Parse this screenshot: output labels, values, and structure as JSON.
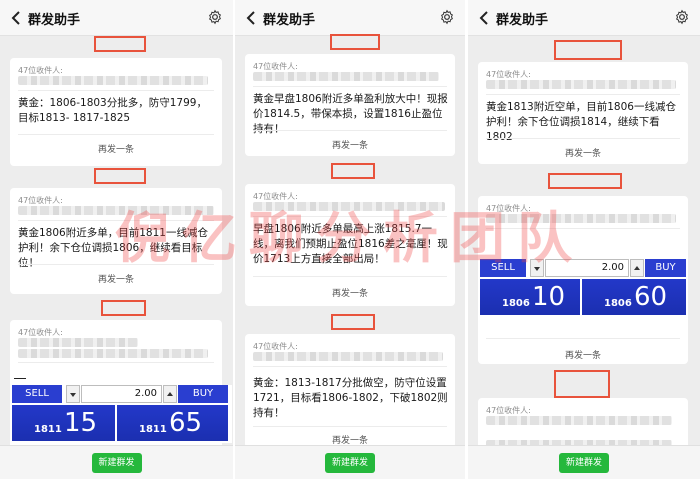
{
  "header": {
    "title": "群发助手"
  },
  "receiver_label": "47位收件人:",
  "resend_label": "再发一条",
  "new_broadcast_label": "新建群发",
  "watermark": "倪亿聊分析团队",
  "colors": {
    "accent": "#25b83c",
    "trade_blue": "#2a3ed0",
    "highlight_red": "#e8533c"
  },
  "trade_widget": {
    "sell_label": "SELL",
    "buy_label": "BUY",
    "quantity": "2.00"
  },
  "panel1": {
    "msg1": "黄金：1806-1803分批多，防守1799，目标1813- 1817-1825",
    "msg2": "黄金1806附近多单，目前1811一线减仓护利！余下仓位调损1806，继续看目标位！",
    "trade": {
      "sell_price_small": "1811",
      "sell_price_big": "15",
      "buy_price_small": "1811",
      "buy_price_big": "65"
    }
  },
  "panel2": {
    "msg1": "黄金早盘1806附近多单盈利放大中！现报价1814.5，带保本损，设置1816止盈位持有！",
    "msg2": "早盘1806附近多单最高上涨1815.7一线，离我们预期止盈位1816差之毫厘！现价1713上方直接全部出局！",
    "msg3": "黄金：1813-1817分批做空，防守位设置1721，目标看1806-1802，下破1802则持有！"
  },
  "panel3": {
    "msg1": "黄金1813附近空单，目前1806一线减仓护利！余下仓位调损1814，继续下看1802",
    "trade": {
      "sell_price_small": "1806",
      "sell_price_big": "10",
      "buy_price_small": "1806",
      "buy_price_big": "60"
    }
  }
}
